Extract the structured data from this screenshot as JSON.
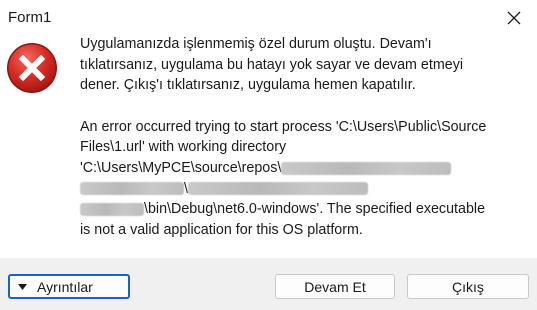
{
  "window": {
    "title": "Form1"
  },
  "message": {
    "line1": "Uygulamanızda işlenmemiş özel durum oluştu. Devam'ı",
    "line2": "tıklatırsanız, uygulama bu hatayı yok sayar ve devam etmeyi",
    "line3": "dener. Çıkış'ı tıklatırsanız, uygulama hemen kapatılır.",
    "line4": "An error occurred trying to start process 'C:\\Users\\Public\\Source",
    "line5": "Files\\1.url' with working directory",
    "line6_prefix": "'C:\\Users\\MyPCE\\source\\repos\\",
    "line7": "\\",
    "line8_suffix": "\\bin\\Debug\\net6.0-windows'. The specified executable",
    "line9": "is not a valid application for this OS platform."
  },
  "buttons": {
    "details": "Ayrıntılar",
    "continue": "Devam Et",
    "quit": "Çıkış"
  },
  "icons": {
    "close": "close-icon",
    "error": "error-icon",
    "details": "triangle-down-icon"
  },
  "colors": {
    "error_red": "#cc1f1f",
    "focus_blue": "#1a63c6",
    "footer_bg": "#f0f0f0"
  }
}
